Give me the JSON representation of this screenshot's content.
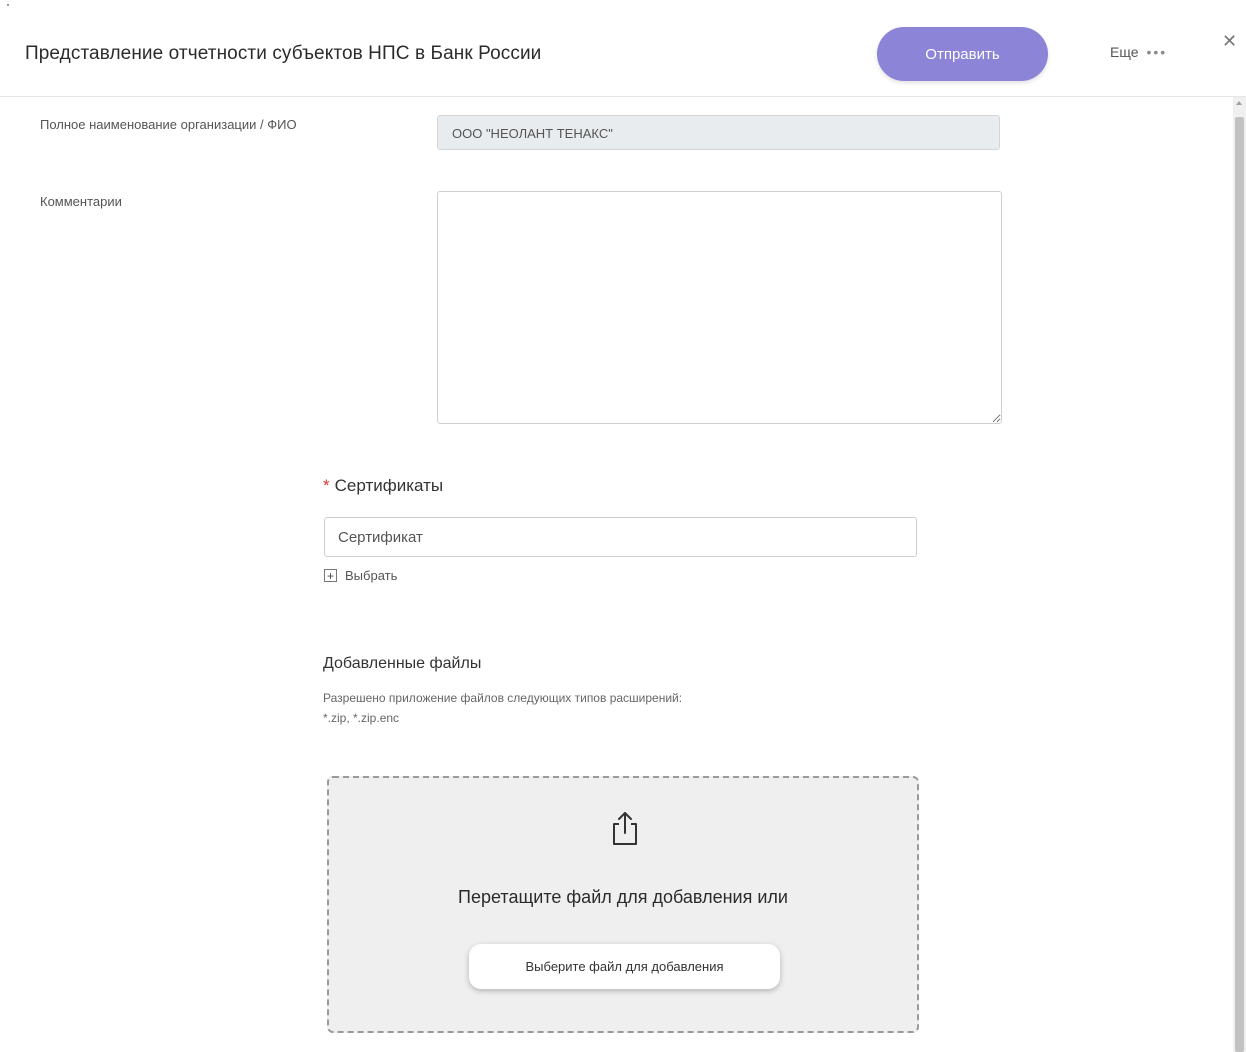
{
  "header": {
    "title": "Представление отчетности субъектов НПС в Банк России",
    "send_label": "Отправить",
    "more_label": "Еще",
    "more_icon": "more-dots-icon",
    "close_icon": "close-icon"
  },
  "form": {
    "org_label": "Полное наименование организации / ФИО",
    "org_value": "ООО \"НЕОЛАНТ ТЕНАКС\"",
    "comment_label": "Комментарии",
    "comment_value": ""
  },
  "certificates": {
    "required_mark": "*",
    "heading": "Сертификаты",
    "input_placeholder": "Сертификат",
    "choose_label": "Выбрать"
  },
  "files": {
    "heading": "Добавленные файлы",
    "note_line1": "Разрешено приложение файлов следующих типов расширений:",
    "note_line2": "*.zip, *.zip.enc",
    "drop_text": "Перетащите файл для добавления или",
    "pick_button": "Выберите файл для добавления",
    "upload_icon": "upload-icon"
  },
  "colors": {
    "accent": "#8b84d7",
    "required": "#d9342b",
    "dropzone_bg": "#efefef"
  }
}
